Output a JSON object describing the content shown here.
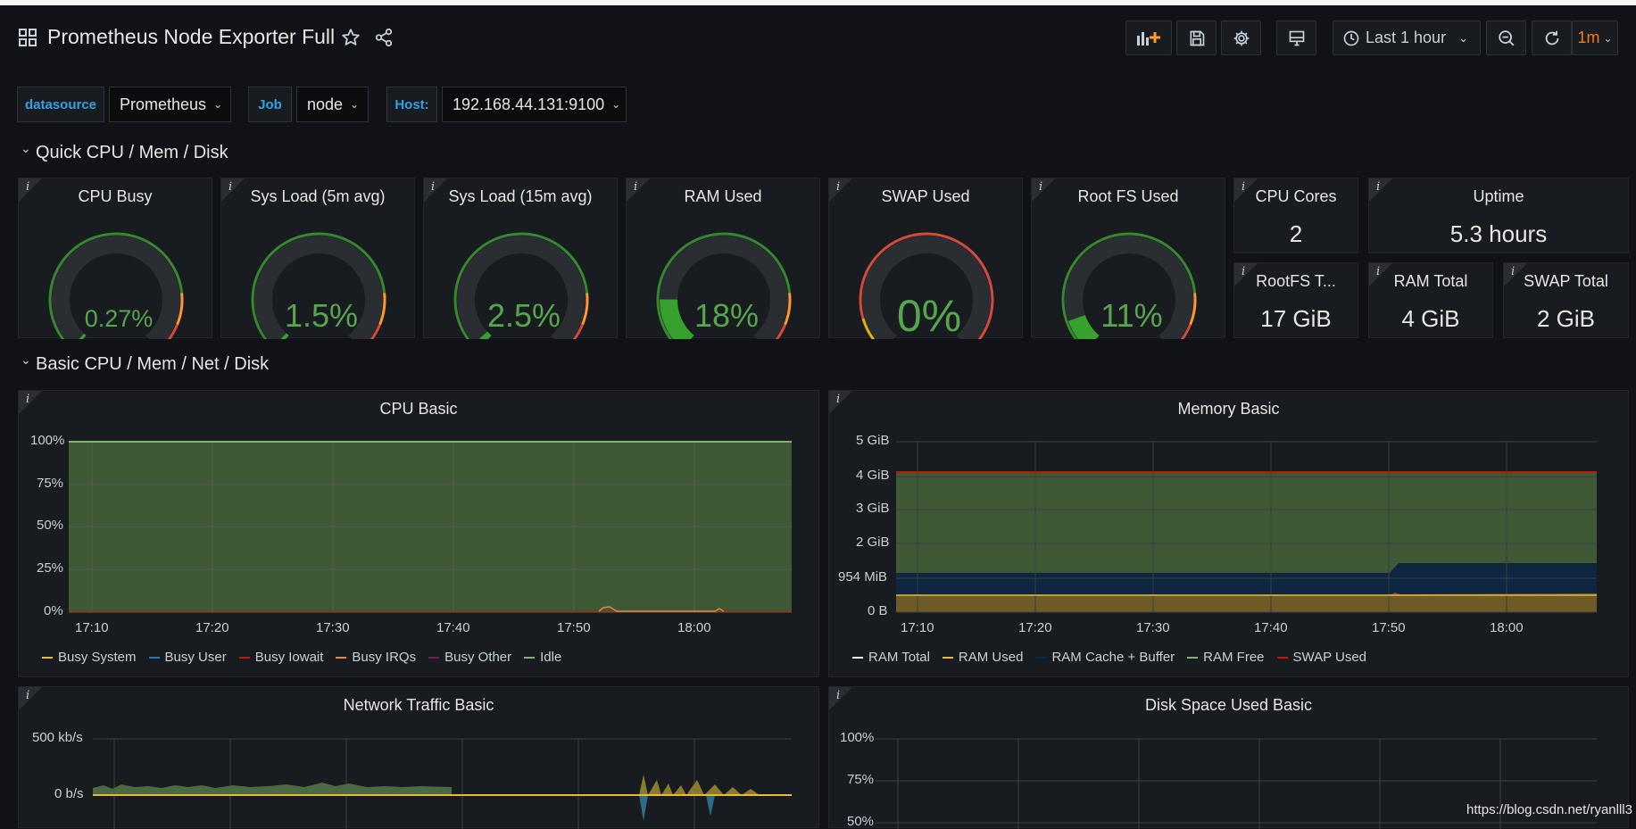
{
  "header": {
    "title": "Prometheus Node Exporter Full",
    "time_range": "Last 1 hour",
    "refresh": "1m"
  },
  "variables": [
    {
      "label": "datasource",
      "value": "Prometheus"
    },
    {
      "label": "Job",
      "value": "node"
    },
    {
      "label": "Host:",
      "value": "192.168.44.131:9100"
    }
  ],
  "rows": {
    "quick": "Quick CPU / Mem / Disk",
    "basic": "Basic CPU / Mem / Net / Disk"
  },
  "gauges": [
    {
      "title": "CPU Busy",
      "value": "0.27%",
      "fraction": 0.0027
    },
    {
      "title": "Sys Load (5m avg)",
      "value": "1.5%",
      "fraction": 0.015
    },
    {
      "title": "Sys Load (15m avg)",
      "value": "2.5%",
      "fraction": 0.025
    },
    {
      "title": "RAM Used",
      "value": "18%",
      "fraction": 0.18
    },
    {
      "title": "SWAP Used",
      "value": "0%",
      "fraction": 0.0
    },
    {
      "title": "Root FS Used",
      "value": "11%",
      "fraction": 0.11
    }
  ],
  "stats": [
    {
      "title": "CPU Cores",
      "value": "2"
    },
    {
      "title": "Uptime",
      "value": "5.3 hours"
    },
    {
      "title": "RootFS T...",
      "value": "17 GiB"
    },
    {
      "title": "RAM Total",
      "value": "4 GiB"
    },
    {
      "title": "SWAP Total",
      "value": "2 GiB"
    }
  ],
  "panels": {
    "cpu_basic": {
      "title": "CPU Basic",
      "y_ticks": [
        "100%",
        "75%",
        "50%",
        "25%",
        "0%"
      ],
      "x_ticks": [
        "17:10",
        "17:20",
        "17:30",
        "17:40",
        "17:50",
        "18:00"
      ],
      "legend": [
        {
          "name": "Busy System",
          "color": "#eab839"
        },
        {
          "name": "Busy User",
          "color": "#1f78c1"
        },
        {
          "name": "Busy Iowait",
          "color": "#bf1b00"
        },
        {
          "name": "Busy IRQs",
          "color": "#ef843c"
        },
        {
          "name": "Busy Other",
          "color": "#6d1f62"
        },
        {
          "name": "Idle",
          "color": "#7eb26d"
        }
      ]
    },
    "memory_basic": {
      "title": "Memory Basic",
      "y_ticks": [
        "5 GiB",
        "4 GiB",
        "3 GiB",
        "2 GiB",
        "954 MiB",
        "0 B"
      ],
      "x_ticks": [
        "17:10",
        "17:20",
        "17:30",
        "17:40",
        "17:50",
        "18:00"
      ],
      "legend": [
        {
          "name": "RAM Total",
          "color": "#ffffff"
        },
        {
          "name": "RAM Used",
          "color": "#eab839"
        },
        {
          "name": "RAM Cache + Buffer",
          "color": "#052b51"
        },
        {
          "name": "RAM Free",
          "color": "#7eb26d"
        },
        {
          "name": "SWAP Used",
          "color": "#bf1b00"
        }
      ]
    },
    "network_basic": {
      "title": "Network Traffic Basic",
      "y_ticks": [
        "500 kb/s",
        "0 b/s"
      ]
    },
    "disk_basic": {
      "title": "Disk Space Used Basic",
      "y_ticks": [
        "100%",
        "75%",
        "50%"
      ]
    }
  },
  "watermark": "https://blog.csdn.net/ryanlll3",
  "colors": {
    "background": "#111217",
    "panel": "#181b1f",
    "green": "#37872d",
    "gauge_green": "#56a64b",
    "accent_orange": "#ff780a",
    "link_blue": "#33a2e5"
  }
}
